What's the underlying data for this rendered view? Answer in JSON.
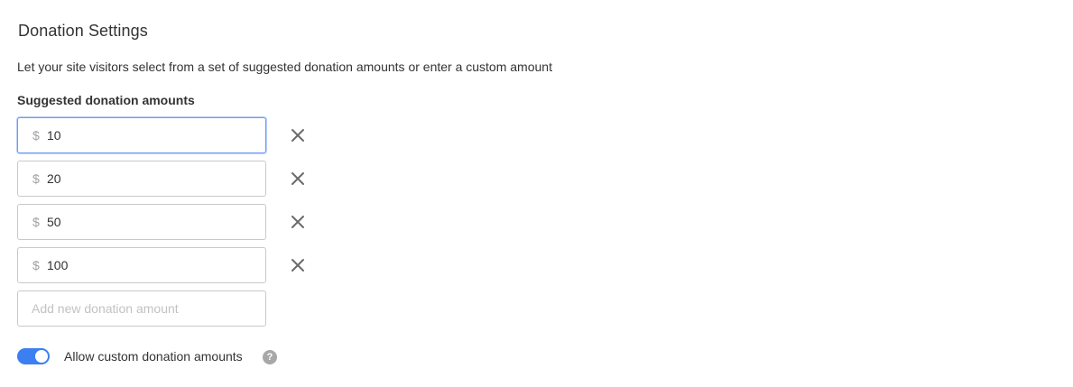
{
  "section": {
    "title": "Donation Settings",
    "description": "Let your site visitors select from a set of suggested donation amounts or enter a custom amount",
    "amounts_label": "Suggested donation amounts"
  },
  "amounts": [
    {
      "currency": "$",
      "value": "10",
      "focused": true
    },
    {
      "currency": "$",
      "value": "20",
      "focused": false
    },
    {
      "currency": "$",
      "value": "50",
      "focused": false
    },
    {
      "currency": "$",
      "value": "100",
      "focused": false
    }
  ],
  "new_amount": {
    "placeholder": "Add new donation amount",
    "value": ""
  },
  "custom_toggle": {
    "label": "Allow custom donation amounts",
    "enabled": true,
    "help_icon": "question-mark-icon",
    "help_glyph": "?"
  },
  "icons": {
    "remove": "close-icon"
  },
  "colors": {
    "accent": "#3b7ff0",
    "focus_border": "#6e9cf3",
    "icon": "#6b6b6b"
  }
}
